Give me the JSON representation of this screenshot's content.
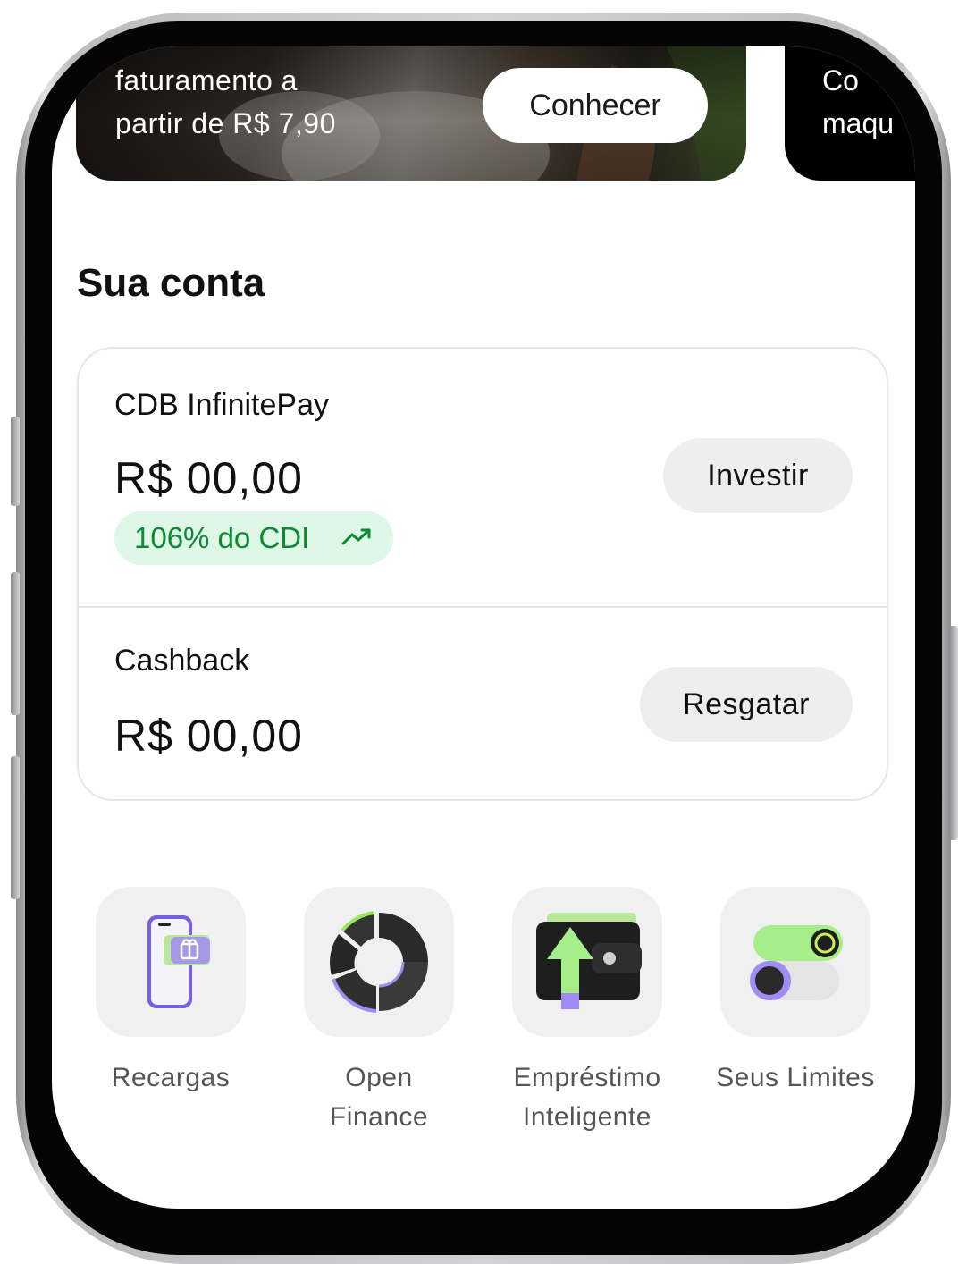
{
  "banners": [
    {
      "text_line1": "faturamento a",
      "text_line2": "partir de R$ 7,90",
      "button_label": "Conhecer"
    },
    {
      "text_line1": "Co",
      "text_line2": "maqu"
    }
  ],
  "account": {
    "section_title": "Sua conta",
    "cdb": {
      "title": "CDB InfinitePay",
      "value": "R$ 00,00",
      "badge": "106% do CDI",
      "badge_icon": "trending-up-icon",
      "button_label": "Investir"
    },
    "cashback": {
      "title": "Cashback",
      "value": "R$ 00,00",
      "button_label": "Resgatar"
    }
  },
  "shortcuts": [
    {
      "label": "Recargas",
      "icon": "phone-gift-icon"
    },
    {
      "label": "Open\nFinance",
      "icon": "donut-chart-icon"
    },
    {
      "label": "Empréstimo\nInteligente",
      "icon": "wallet-arrow-up-icon"
    },
    {
      "label": "Seus Limites",
      "icon": "toggle-switches-icon"
    }
  ],
  "colors": {
    "badge_bg": "#dff7e6",
    "badge_text": "#0a8a35",
    "accent_green": "#9be65c",
    "accent_purple": "#a18bf5",
    "button_bg": "#eeeeee"
  }
}
